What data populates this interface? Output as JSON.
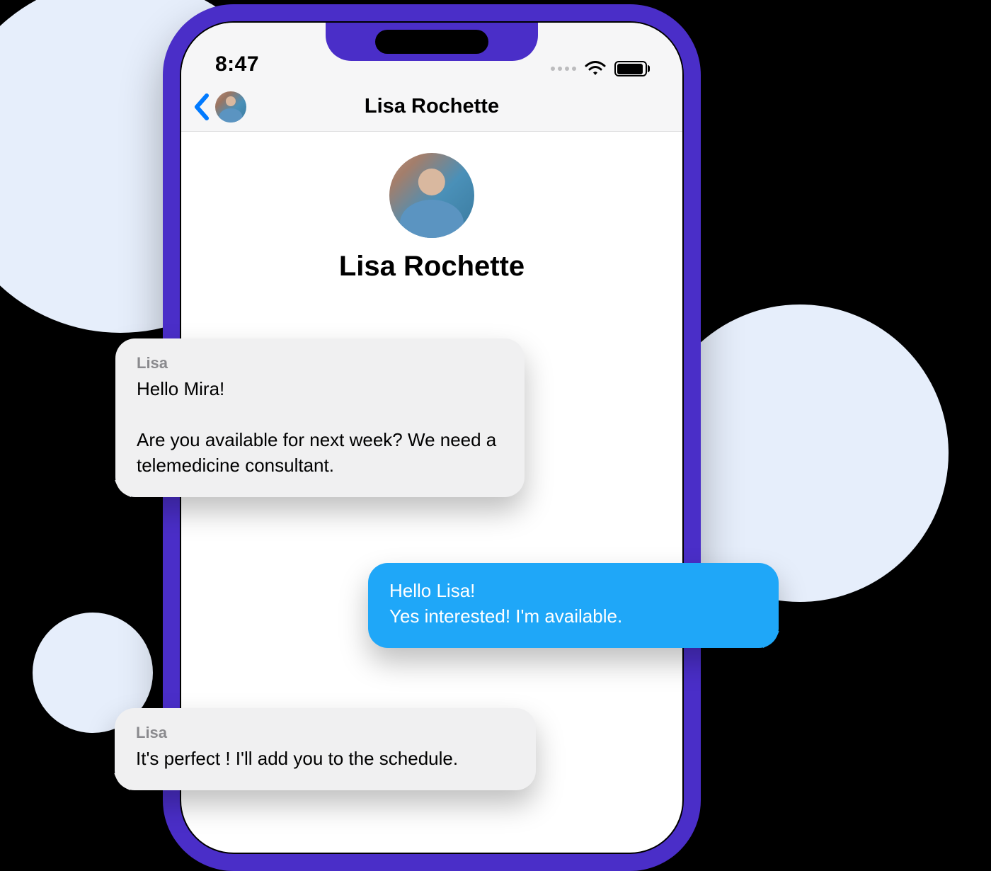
{
  "status_bar": {
    "time": "8:47"
  },
  "header": {
    "title": "Lisa Rochette"
  },
  "profile": {
    "name": "Lisa Rochette"
  },
  "messages": [
    {
      "sender": "Lisa",
      "text": "Hello Mira!\n\nAre you available for next week? We need a telemedicine consultant.",
      "type": "received"
    },
    {
      "sender": "",
      "text": "Hello Lisa!\nYes interested! I'm available.",
      "type": "sent"
    },
    {
      "sender": "Lisa",
      "text": "It's perfect ! I'll add you to the schedule.",
      "type": "received"
    }
  ],
  "colors": {
    "phone_frame": "#4a2ec8",
    "sent_bubble": "#1fa7f8",
    "received_bubble": "#f0f0f1",
    "accent_blue": "#007aff",
    "bg_circle": "#e6eefb"
  }
}
